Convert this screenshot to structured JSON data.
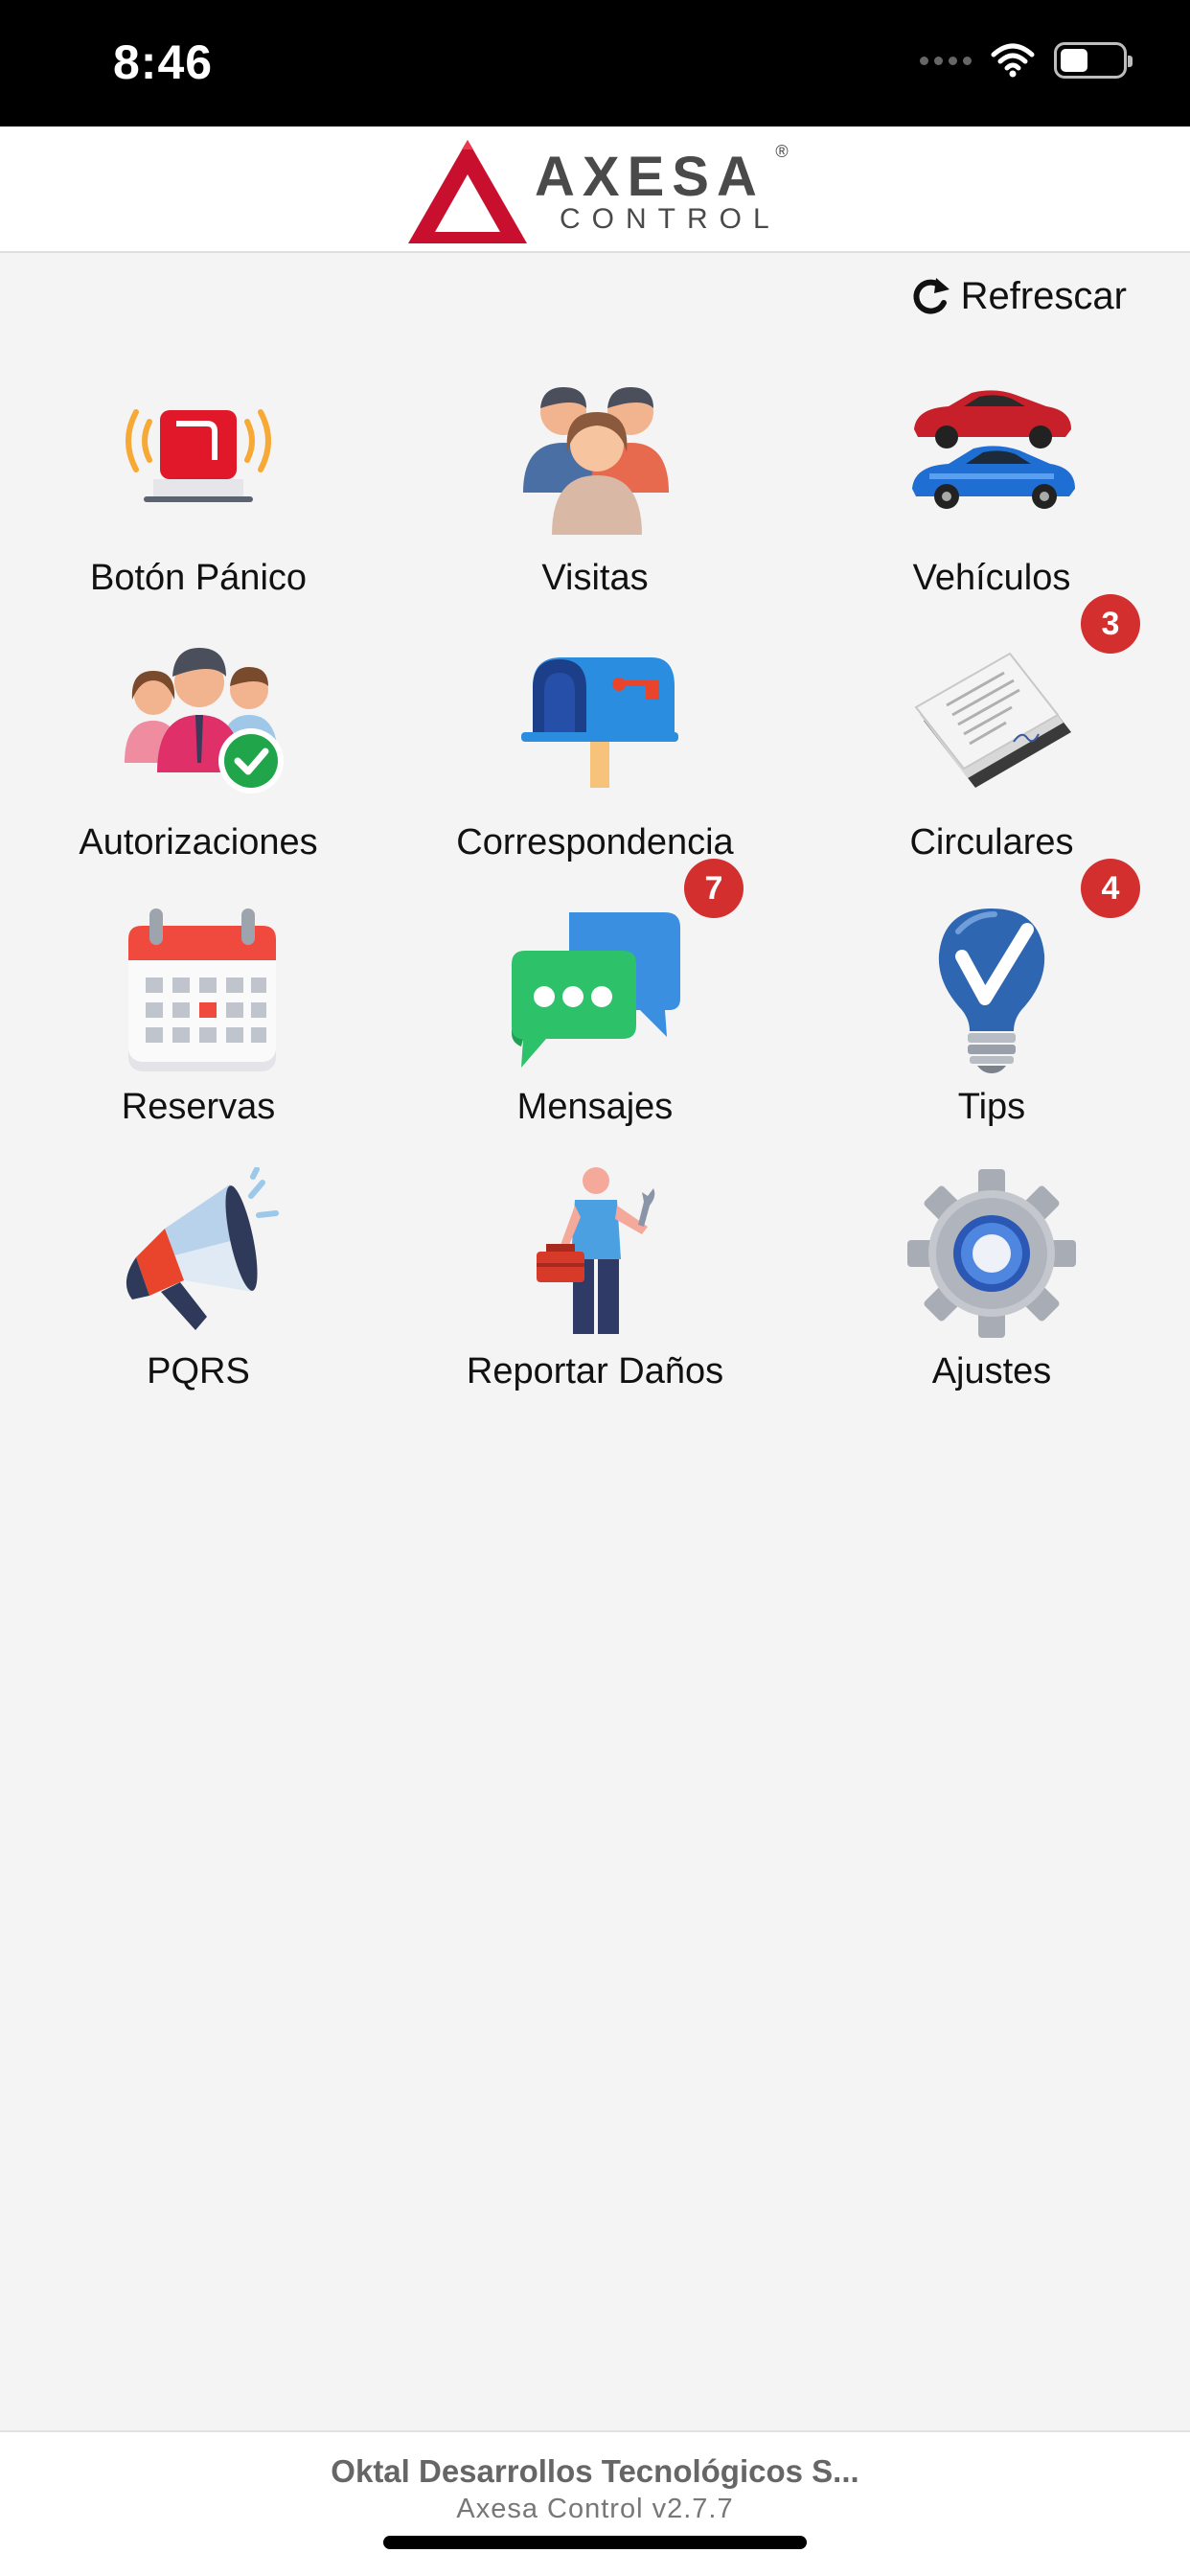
{
  "status_bar": {
    "time": "8:46",
    "icons": [
      "cellular-icon",
      "wifi-icon",
      "battery-icon"
    ]
  },
  "header": {
    "logo_main": "AXESA",
    "logo_sub": "CONTROL",
    "logo_reg": "®"
  },
  "refresh": {
    "label": "Refrescar",
    "icon": "refresh-icon"
  },
  "menu": [
    {
      "label": "Botón Pánico",
      "icon": "panic-alarm-icon"
    },
    {
      "label": "Visitas",
      "icon": "visitors-icon"
    },
    {
      "label": "Vehículos",
      "icon": "vehicles-icon"
    },
    {
      "label": "Autorizaciones",
      "icon": "authorizations-icon"
    },
    {
      "label": "Correspondencia",
      "icon": "mailbox-icon"
    },
    {
      "label": "Circulares",
      "icon": "documents-icon",
      "badge": "3"
    },
    {
      "label": "Reservas",
      "icon": "calendar-icon"
    },
    {
      "label": "Mensajes",
      "icon": "chat-icon",
      "badge": "7"
    },
    {
      "label": "Tips",
      "icon": "lightbulb-icon",
      "badge": "4"
    },
    {
      "label": "PQRS",
      "icon": "megaphone-icon"
    },
    {
      "label": "Reportar Daños",
      "icon": "repairman-icon"
    },
    {
      "label": "Ajustes",
      "icon": "gear-icon"
    }
  ],
  "footer": {
    "company": "Oktal Desarrollos Tecnológicos S...",
    "version": "Axesa Control v2.7.7"
  },
  "colors": {
    "badge": "#d32f2f",
    "brand_red": "#c8102e",
    "background": "#f4f4f5"
  }
}
